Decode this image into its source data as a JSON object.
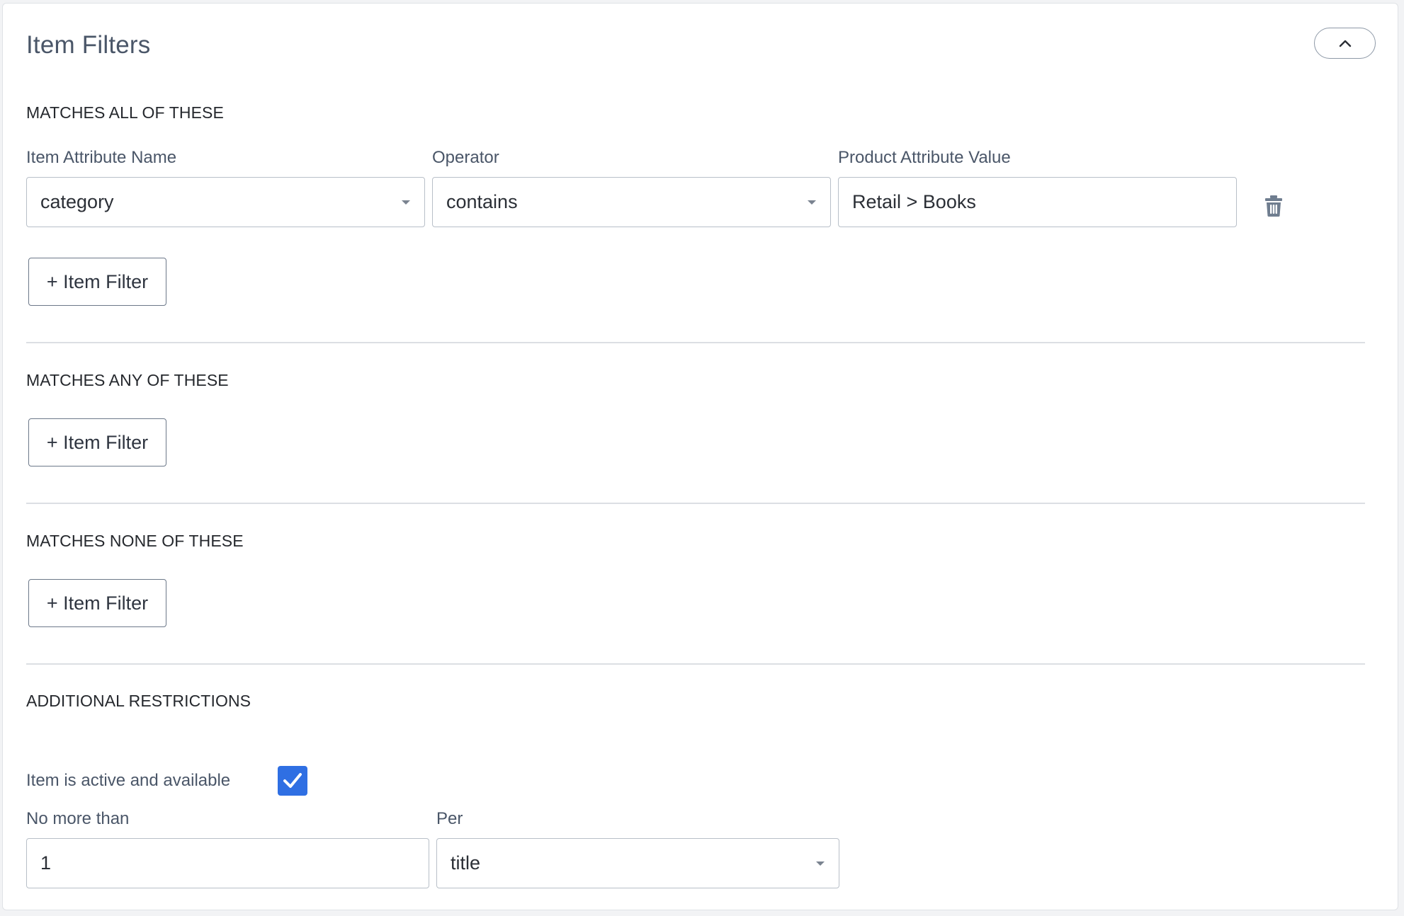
{
  "panel": {
    "title": "Item Filters"
  },
  "icons": {
    "collapse": "chevron-up-icon",
    "delete": "trash-icon",
    "checkbox": "checkmark-icon"
  },
  "colors": {
    "accent": "#2f6fe3",
    "label": "#4a5668",
    "heading": "#25282d"
  },
  "sections": {
    "all": {
      "heading": "MATCHES ALL OF THESE",
      "columns": {
        "attribute_name": "Item Attribute Name",
        "operator": "Operator",
        "value": "Product Attribute Value"
      },
      "row": {
        "attribute_name": "category",
        "operator": "contains",
        "value": "Retail > Books"
      },
      "add_label": "+ Item Filter"
    },
    "any": {
      "heading": "MATCHES ANY OF THESE",
      "add_label": "+ Item Filter"
    },
    "none": {
      "heading": "MATCHES NONE OF THESE",
      "add_label": "+ Item Filter"
    },
    "restrictions": {
      "heading": "ADDITIONAL RESTRICTIONS",
      "active_label": "Item is active and available",
      "active_checked": true,
      "no_more_than_label": "No more than",
      "no_more_than_value": "1",
      "per_label": "Per",
      "per_value": "title"
    }
  }
}
